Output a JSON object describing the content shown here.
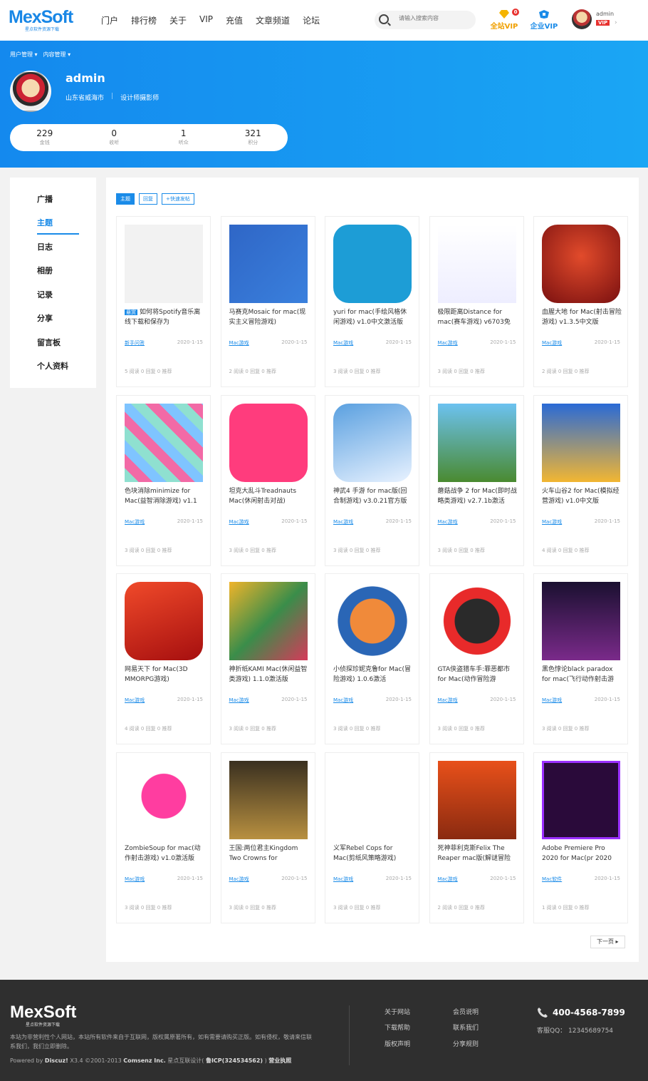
{
  "brand": {
    "name": "MexSoft",
    "tagline": "星点软件资源下载"
  },
  "nav": [
    "门户",
    "排行榜",
    "关于",
    "VIP",
    "充值",
    "文章频道",
    "论坛"
  ],
  "search": {
    "placeholder": "请输入搜索内容"
  },
  "vip": {
    "all": "全站VIP",
    "enterprise": "企业VIP",
    "badge": "0"
  },
  "user": {
    "name": "admin",
    "vip": "VIP"
  },
  "breadcrumbs": [
    "用户管理 ▾",
    "内容管理 ▾"
  ],
  "profile": {
    "name": "admin",
    "location": "山东省威海市",
    "title": "设计师摄影师",
    "stats": [
      {
        "value": "229",
        "label": "金钱"
      },
      {
        "value": "0",
        "label": "收听"
      },
      {
        "value": "1",
        "label": "听众"
      },
      {
        "value": "321",
        "label": "积分"
      }
    ]
  },
  "sidebar": [
    "广播",
    "主题",
    "日志",
    "相册",
    "记录",
    "分享",
    "留言板",
    "个人资料"
  ],
  "filters": [
    "主题",
    "回复",
    "+快速发帖"
  ],
  "cards": [
    {
      "tag": "悬赏",
      "title": "如何将Spotify音乐离线下载和保存为",
      "cat": "新手问答",
      "date": "2020-1-15",
      "meta": "5 阅读   0 回复   0 推荐"
    },
    {
      "title": "马赛克Mosaic for mac(现实主义冒险游戏)",
      "cat": "Mac游戏",
      "date": "2020-1-15",
      "meta": "2 阅读   0 回复   0 推荐"
    },
    {
      "title": "yuri for mac(手绘风格休闲游戏) v1.0中文激活版",
      "cat": "Mac游戏",
      "date": "2020-1-15",
      "meta": "3 阅读   0 回复   0 推荐"
    },
    {
      "title": "极限距离Distance for mac(赛车游戏) v6703免",
      "cat": "Mac游戏",
      "date": "2020-1-15",
      "meta": "3 阅读   0 回复   0 推荐"
    },
    {
      "title": "血腥大地 for Mac(射击冒险游戏) v1.3.5中文版",
      "cat": "Mac游戏",
      "date": "2020-1-15",
      "meta": "2 阅读   0 回复   0 推荐"
    },
    {
      "title": "色块消除minimize for Mac(益智消除游戏) v1.1",
      "cat": "Mac游戏",
      "date": "2020-1-15",
      "meta": "3 阅读   0 回复   0 推荐"
    },
    {
      "title": "坦克大乱斗Treadnauts Mac(休闲射击对战)",
      "cat": "Mac游戏",
      "date": "2020-1-15",
      "meta": "3 阅读   0 回复   0 推荐"
    },
    {
      "title": "神武4 手游 for mac版(回合制游戏) v3.0.21官方版",
      "cat": "Mac游戏",
      "date": "2020-1-15",
      "meta": "3 阅读   0 回复   0 推荐"
    },
    {
      "title": "蘑菇战争 2 for Mac(即时战略类游戏) v2.7.1b激活",
      "cat": "Mac游戏",
      "date": "2020-1-15",
      "meta": "3 阅读   0 回复   0 推荐"
    },
    {
      "title": "火车山谷2 for Mac(模拟经营游戏) v1.0中文版",
      "cat": "Mac游戏",
      "date": "2020-1-15",
      "meta": "4 阅读   0 回复   0 推荐"
    },
    {
      "title": "网易天下 for Mac(3D MMORPG游戏)",
      "cat": "Mac游戏",
      "date": "2020-1-15",
      "meta": "4 阅读   0 回复   0 推荐"
    },
    {
      "title": "神折纸KAMI Mac(休闲益智类游戏) 1.1.0激活版",
      "cat": "Mac游戏",
      "date": "2020-1-15",
      "meta": "3 阅读   0 回复   0 推荐"
    },
    {
      "title": "小侦探珍妮克鲁for Mac(冒险游戏) 1.0.6激活",
      "cat": "Mac游戏",
      "date": "2020-1-15",
      "meta": "3 阅读   0 回复   0 推荐"
    },
    {
      "title": "GTA侠盗猎车手:罪恶都市 for Mac(动作冒险游",
      "cat": "Mac游戏",
      "date": "2020-1-15",
      "meta": "3 阅读   0 回复   0 推荐"
    },
    {
      "title": "黑色悖论black paradox for mac(飞行动作射击游",
      "cat": "Mac游戏",
      "date": "2020-1-15",
      "meta": "3 阅读   0 回复   0 推荐"
    },
    {
      "title": "ZombieSoup for mac(动作射击游戏) v1.0激活版",
      "cat": "Mac游戏",
      "date": "2020-1-15",
      "meta": "3 阅读   0 回复   0 推荐"
    },
    {
      "title": "王国:两位君主Kingdom Two Crowns for",
      "cat": "Mac游戏",
      "date": "2020-1-15",
      "meta": "3 阅读   0 回复   0 推荐"
    },
    {
      "title": "义军Rebel Cops for Mac(剪纸风策略游戏)",
      "cat": "Mac游戏",
      "date": "2020-1-15",
      "meta": "3 阅读   0 回复   0 推荐"
    },
    {
      "title": "死神菲利克斯Felix The Reaper mac版(解谜冒险",
      "cat": "Mac游戏",
      "date": "2020-1-15",
      "meta": "2 阅读   0 回复   0 推荐"
    },
    {
      "title": "Adobe Premiere Pro 2020 for Mac(pr 2020",
      "cat": "Mac软件",
      "date": "2020-1-15",
      "meta": "1 阅读   0 回复   0 推荐"
    }
  ],
  "pager": "下一页 ▸",
  "footer": {
    "desc": "本站为非营利性个人网站，本站所有软件来自于互联网，版权属原著所有，如有需要请购买正版。如有侵权，敬请来信联系我们，我们立即删除。",
    "copy_a": "Powered by ",
    "discuz": "Discuz!",
    "copy_b": " X3.4 ©2001-2013 ",
    "company": "Comsenz Inc.",
    "copy_c": " 星点互联设计( ",
    "icp": "鲁ICP(324534562)",
    "copy_d": " ) ",
    "license": "营业执照",
    "links": [
      "关于网站",
      "下载帮助",
      "版权声明",
      "会员说明",
      "联系我们",
      "分享规则"
    ],
    "phone": "400-4568-7899",
    "qq": "客服QQ： 12345689754"
  },
  "colors": {
    "accent": "#1a8be8",
    "banner": "#1489ee",
    "footer": "#2f2f2f",
    "vip": "#f0a000",
    "alert": "#e8322f"
  }
}
